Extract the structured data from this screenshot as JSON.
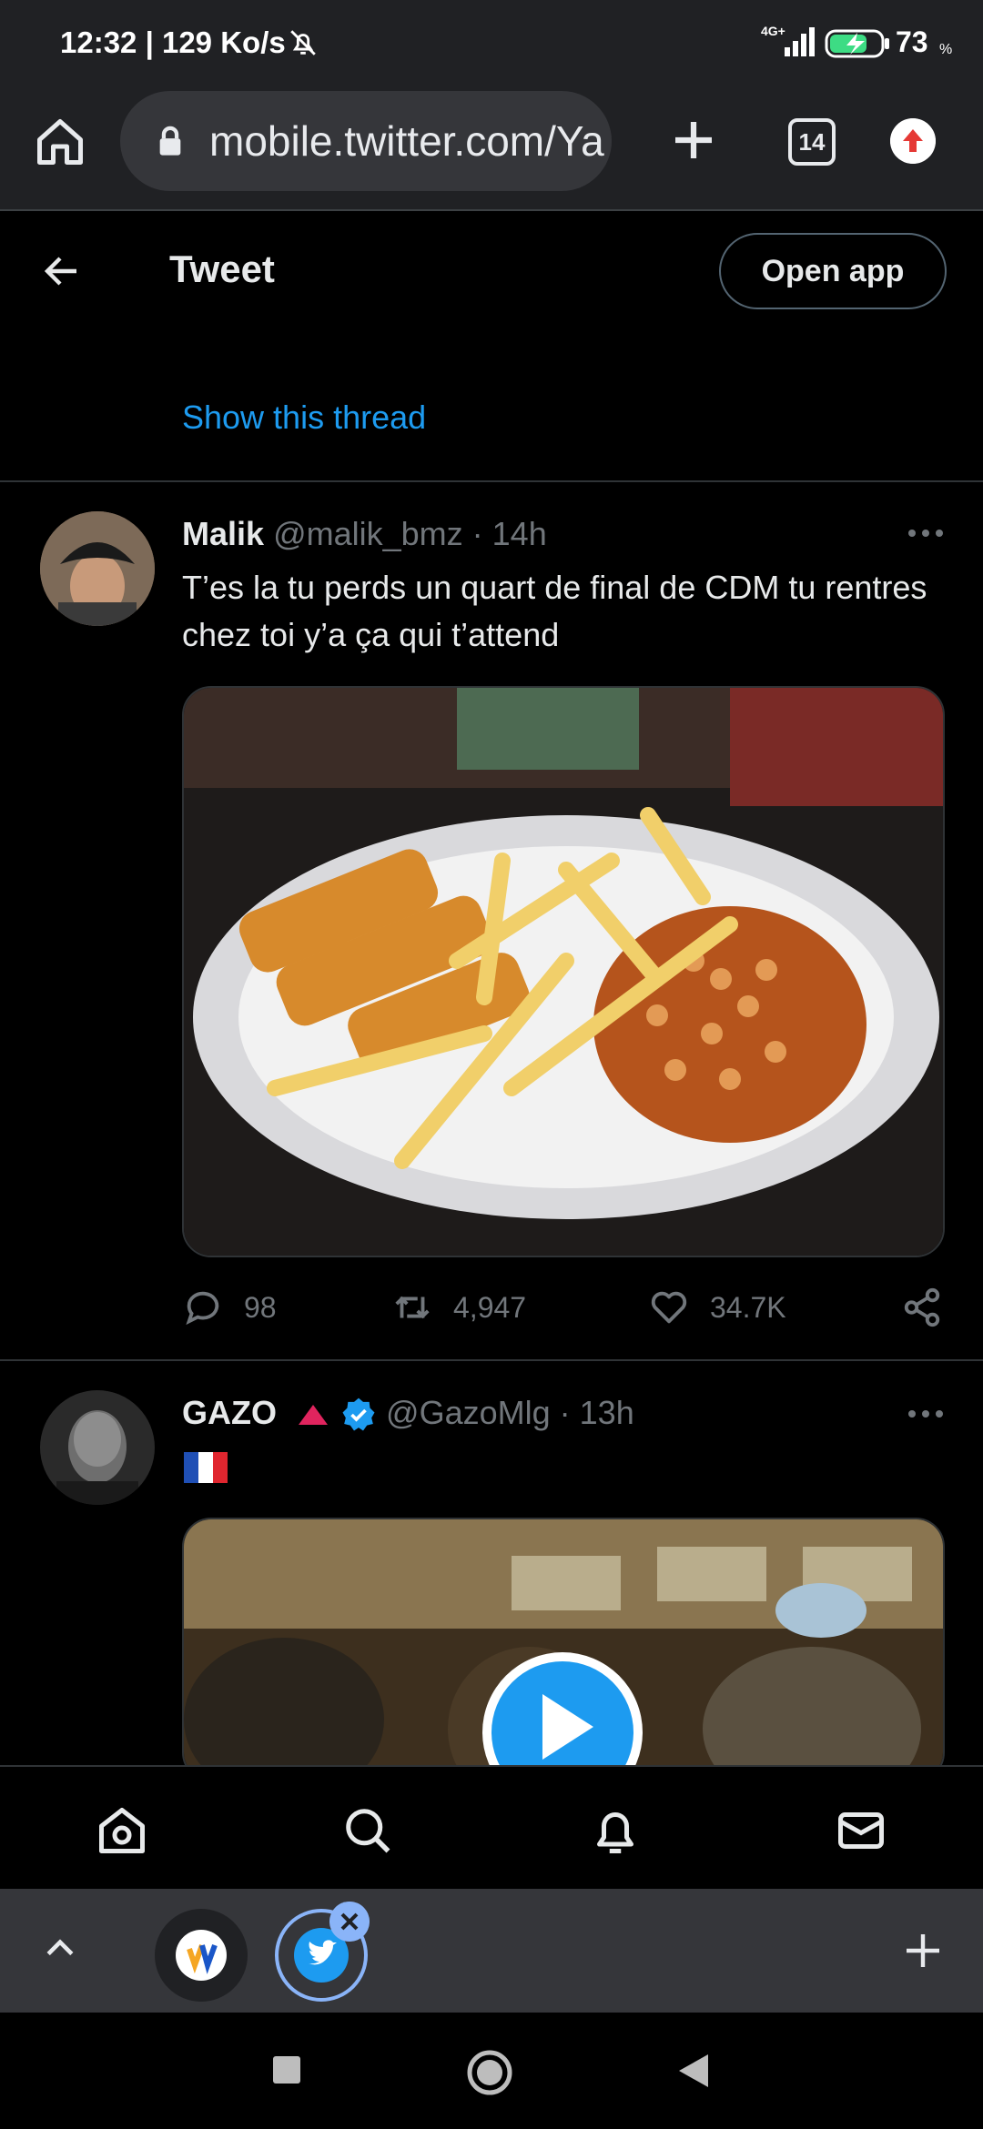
{
  "status_bar": {
    "time": "12:32 | 129 Ko/s",
    "network": "4G+",
    "battery": "73",
    "battery_unit": "%"
  },
  "browser": {
    "url": "mobile.twitter.com/Ya",
    "tab_count": "14"
  },
  "header": {
    "title": "Tweet",
    "open_app": "Open app"
  },
  "thread_link": "Show this thread",
  "tweets": [
    {
      "name": "Malik",
      "handle": "@malik_bmz",
      "time": "· 14h",
      "text": "T’es la tu perds un quart de final de  CDM tu rentres chez toi y’a ça qui t’attend",
      "replies": "98",
      "retweets": "4,947",
      "likes": "34.7K"
    },
    {
      "name": "GAZO",
      "handle": "@GazoMlg",
      "time": "· 13h",
      "text": "🇫🇷"
    }
  ],
  "colors": {
    "accent": "#1d9bf0",
    "muted": "#71767b",
    "background": "#000000"
  },
  "icons": {
    "bottom_nav": [
      "home-icon",
      "search-icon",
      "notifications-icon",
      "messages-icon"
    ]
  }
}
